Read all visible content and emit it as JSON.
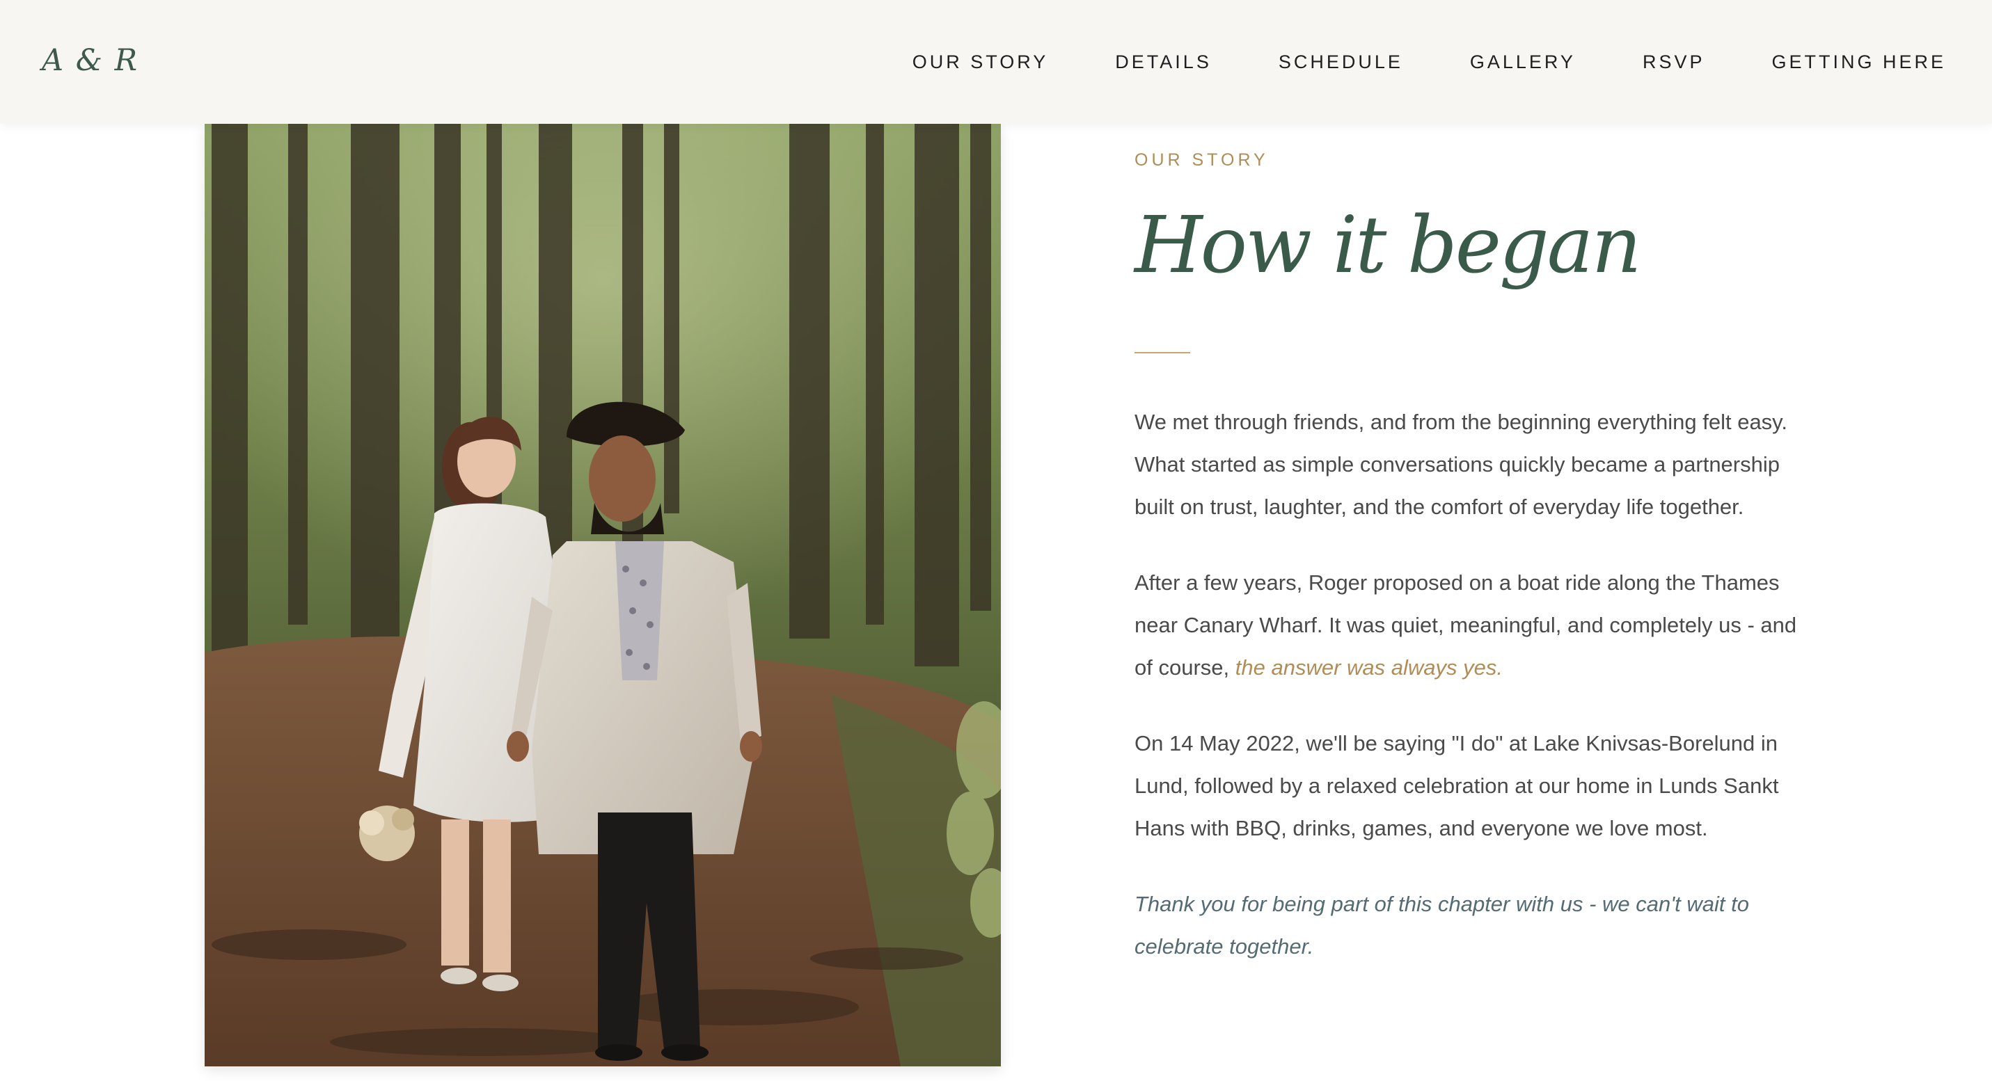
{
  "header": {
    "logo": "A & R",
    "nav": [
      {
        "label": "OUR STORY"
      },
      {
        "label": "DETAILS"
      },
      {
        "label": "SCHEDULE"
      },
      {
        "label": "GALLERY"
      },
      {
        "label": "RSVP"
      },
      {
        "label": "GETTING HERE"
      }
    ]
  },
  "story": {
    "eyebrow": "OUR STORY",
    "heading": "How it began",
    "paragraphs": [
      "We met through friends, and from the beginning everything felt easy. What started as simple conversations quickly became a partnership built on trust, laughter, and the comfort of everyday life together.",
      "After a few years, Roger proposed on a boat ride along the Thames near Canary Wharf. It was quiet, meaningful, and completely us - and of course, ",
      "On 14 May 2022, we'll be saying \"I do\" at Lake Knivsas-Borelund in Lund, followed by a relaxed celebration at our home in Lunds Sankt Hans with BBQ, drinks, games, and everyone we love most."
    ],
    "highlight": "the answer was always yes.",
    "closing": "Thank you for being part of this chapter with us - we can't wait to celebrate together."
  },
  "photo": {
    "alt_icon": "couple-in-forest-photo"
  },
  "colors": {
    "header_bg": "#f7f6f3",
    "brand_green": "#3a5a4a",
    "accent_gold": "#b08d57",
    "body_text": "#4a4a4a"
  }
}
